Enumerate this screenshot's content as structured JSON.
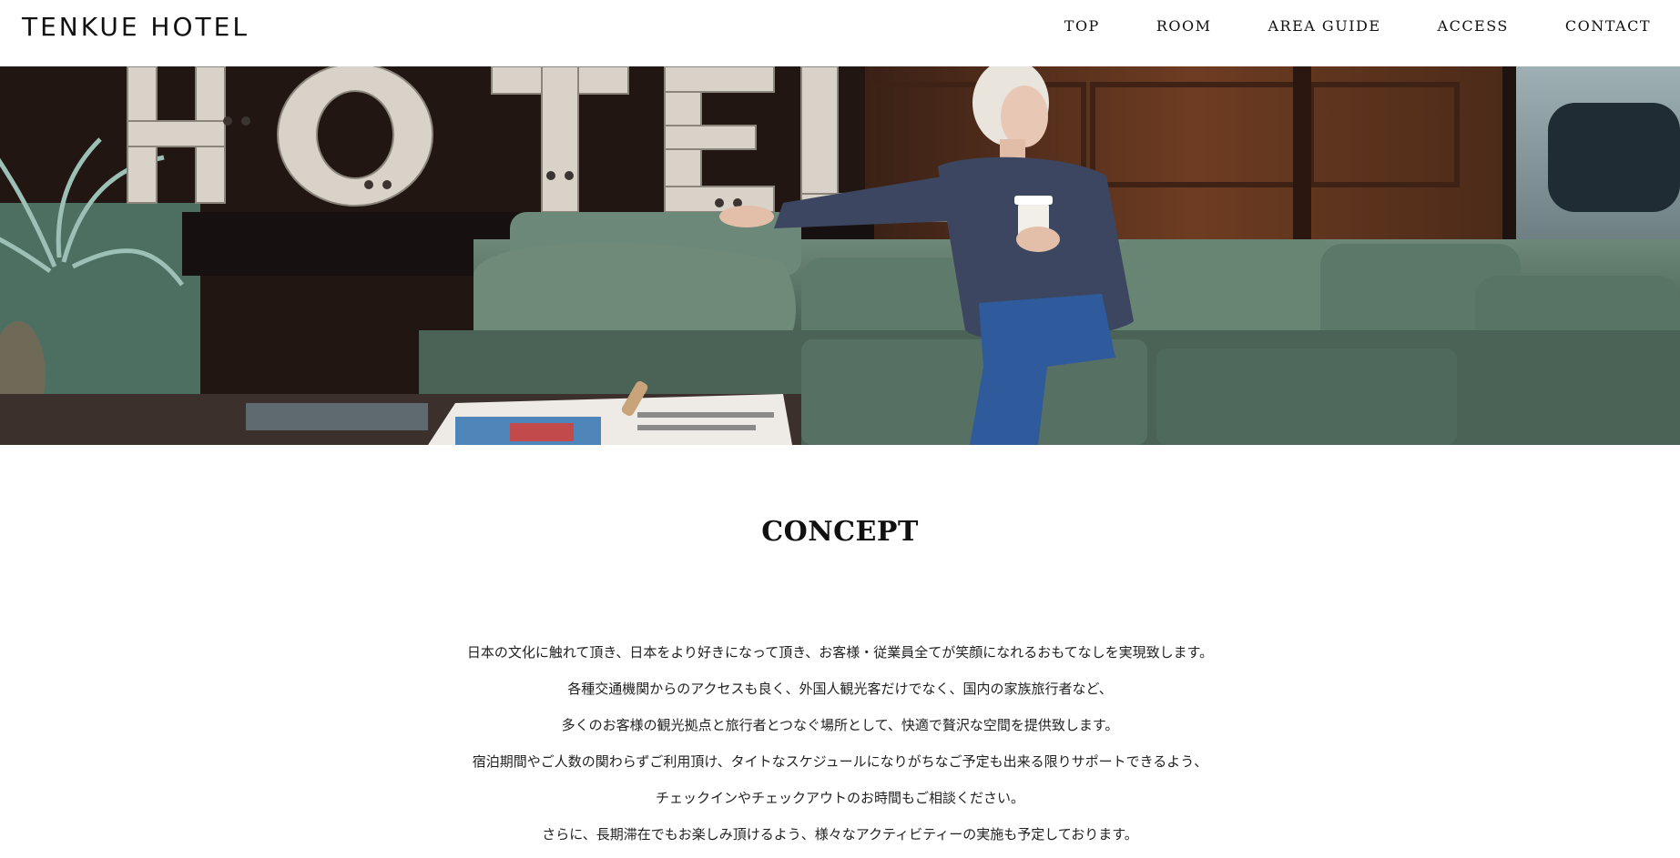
{
  "header": {
    "logo": "TENKUE HOTEL",
    "nav": [
      {
        "label": "TOP"
      },
      {
        "label": "ROOM"
      },
      {
        "label": "AREA GUIDE"
      },
      {
        "label": "ACCESS"
      },
      {
        "label": "CONTACT"
      }
    ]
  },
  "hero": {
    "sign_text": "HOTEL"
  },
  "concept": {
    "title": "CONCEPT",
    "lines": [
      "日本の文化に触れて頂き、日本をより好きになって頂き、お客様・従業員全てが笑顔になれるおもてなしを実現致します。",
      "各種交通機関からのアクセスも良く、外国人観光客だけでなく、国内の家族旅行者など、",
      "多くのお客様の観光拠点と旅行者とつなぐ場所として、快適で贅沢な空間を提供致します。",
      "宿泊期間やご人数の関わらずご利用頂け、タイトなスケジュールになりがちなご予定も出来る限りサポートできるよう、",
      "チェックインやチェックアウトのお時間もご相談ください。",
      "さらに、長期滞在でもお楽しみ頂けるよう、様々なアクティビティーの実施も予定しております。"
    ]
  },
  "colors": {
    "text": "#111111",
    "background": "#ffffff",
    "sofa": "#5f7a6a",
    "wood_panel": "#6b3a22",
    "sweater": "#3c4660",
    "jeans": "#2f5b9c"
  }
}
